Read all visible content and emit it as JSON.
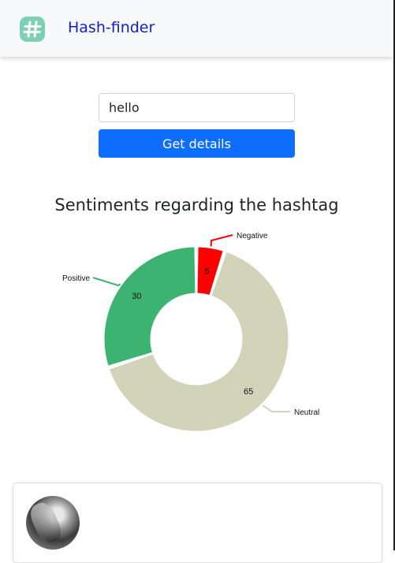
{
  "navbar": {
    "brand": "Hash-finder",
    "logo_icon": "hashtag-icon"
  },
  "search": {
    "value": "hello",
    "button_label": "Get details"
  },
  "chart_title": "Sentiments regarding the hashtag",
  "chart_data": {
    "type": "pie",
    "title": "Sentiments regarding the hashtag",
    "categories": [
      "Negative",
      "Neutral",
      "Positive"
    ],
    "values": [
      5,
      65,
      30
    ],
    "colors": [
      "#ff0000",
      "#d2d4b9",
      "#3cb371"
    ],
    "donut": true
  },
  "card": {
    "avatar": "user-avatar"
  }
}
